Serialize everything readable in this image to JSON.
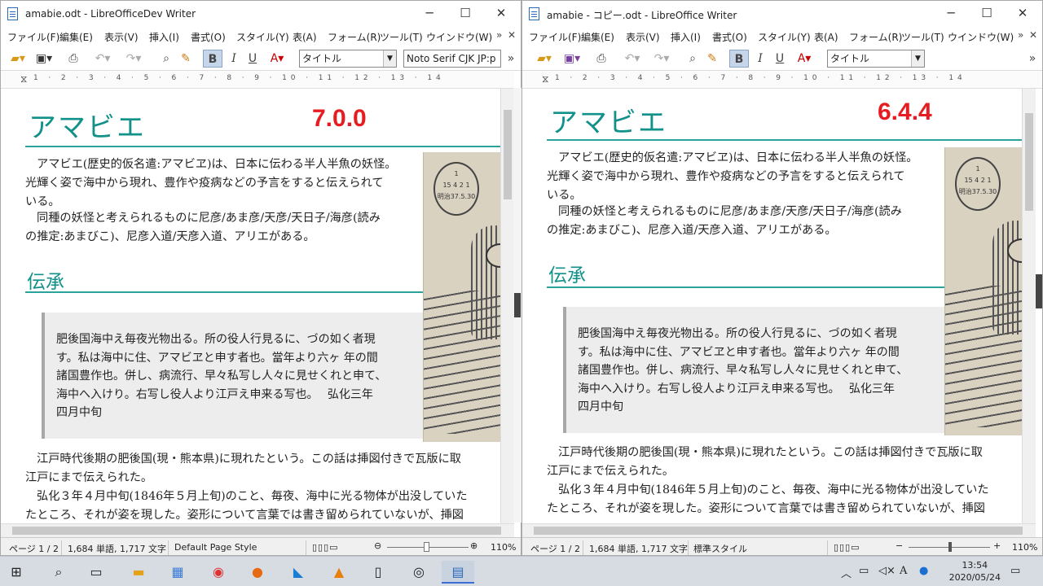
{
  "left": {
    "title": "amabie.odt - LibreOfficeDev Writer",
    "menu": [
      "ファイル(F)",
      "編集(E)",
      "表示(V)",
      "挿入(I)",
      "書式(O)",
      "スタイル(Y)",
      "表(A)",
      "フォーム(R)",
      "ツール(T)",
      "ウインドウ(W)"
    ],
    "para_style": "タイトル",
    "font_name": "Noto Serif CJK JP:p",
    "ruler": "1 · 2 · 3 · 4 · 5 · 6 · 7 · 8 · 9 · 10 · 11 · 12 · 13 · 14",
    "heading": "アマビエ",
    "version": "7.0.0",
    "para1": "アマビエ(歴史的仮名遣:アマビヱ)は、日本に伝わる半人半魚の妖怪。\n光輝く姿で海中から現れ、豊作や疫病などの予言をすると伝えられて\nいる。",
    "para2": "同種の妖怪と考えられるものに尼彦/あま彦/天彦/天日子/海彦(読み\nの推定:あまびこ)、尼彦入道/天彦入道、アリエがある。",
    "section": "伝承",
    "quote": "肥後国海中え毎夜光物出る。所の役人行見るに、づの如く者現\nす。私は海中に住、アマビヱと申す者也。當年より六ヶ 年の間\n諸国豊作也。併し、病流行、早々私写し人々に見せくれと申て、\n海中へ入けり。右写し役人より江戸え申来る写也。　 弘化三年\n四月中旬",
    "para3": "江戸時代後期の肥後国(現・熊本県)に現れたという。この話は挿図付きで瓦版に取\n江戸にまで伝えられた。",
    "para4": "弘化３年４月中旬(1846年５月上旬)のこと、毎夜、海中に光る物体が出没していた\nたところ、それが姿を現した。姿形について言葉では書き留められていないが、挿図",
    "status": {
      "page": "ページ 1 / 2",
      "words": "1,684 単語, 1,717 文字",
      "style": "Default Page Style",
      "zoom": "110%"
    }
  },
  "right": {
    "title": "amabie - コピー.odt - LibreOffice Writer",
    "menu": [
      "ファイル(F)",
      "編集(E)",
      "表示(V)",
      "挿入(I)",
      "書式(O)",
      "スタイル(Y)",
      "表(A)",
      "フォーム(R)",
      "ツール(T)",
      "ウインドウ(W)"
    ],
    "para_style": "タイトル",
    "ruler": "1 · 2 · 3 · 4 · 5 · 6 · 7 · 8 · 9 · 10 · 11 · 12 · 13 · 14",
    "heading": "アマビエ",
    "version": "6.4.4",
    "para1": "アマビエ(歴史的仮名遣:アマビヱ)は、日本に伝わる半人半魚の妖怪。\n光輝く姿で海中から現れ、豊作や疫病などの予言をすると伝えられて\nいる。",
    "para2": "同種の妖怪と考えられるものに尼彦/あま彦/天彦/天日子/海彦(読み\nの推定:あまびこ)、尼彦入道/天彦入道、アリエがある。",
    "section": "伝承",
    "quote": "肥後国海中え毎夜光物出る。所の役人行見るに、づの如く者現\nす。私は海中に住、アマビヱと申す者也。當年より六ヶ 年の間\n諸国豊作也。併し、病流行、早々私写し人々に見せくれと申て、\n海中へ入けり。右写し役人より江戸え申来る写也。　 弘化三年\n四月中旬",
    "para3": "江戸時代後期の肥後国(現・熊本県)に現れたという。この話は挿図付きで瓦版に取\n江戸にまで伝えられた。",
    "para4": "弘化３年４月中旬(1846年５月上旬)のこと、毎夜、海中に光る物体が出没していた\nたところ、それが姿を現した。姿形について言葉では書き留められていないが、挿図",
    "status": {
      "page": "ページ 1 / 2",
      "words": "1,684 単語, 1,717 文字",
      "style": "標準スタイル",
      "zoom": "110%"
    }
  },
  "stamp_text": "1\n15 4 2 1\n明治37.5.30",
  "taskbar": {
    "time": "13:54",
    "date": "2020/05/24"
  },
  "colors": {
    "heading": "#12908a",
    "version": "#e51d22",
    "rule": "#2aa39b"
  }
}
